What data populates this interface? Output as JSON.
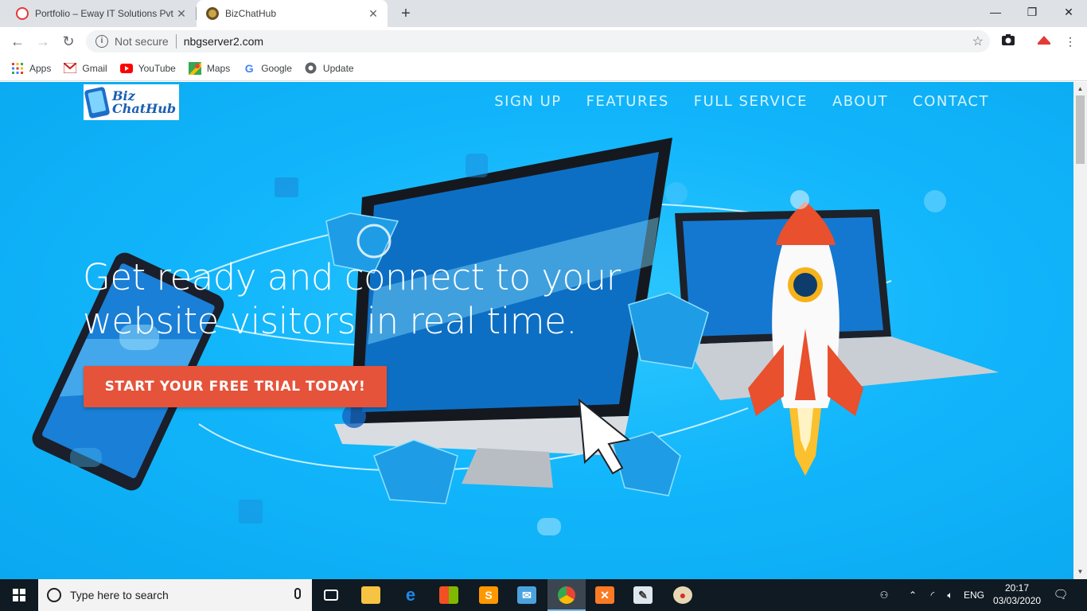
{
  "browser": {
    "tabs": [
      {
        "title": "Portfolio – Eway IT Solutions Pvt",
        "active": false,
        "favicon_color": "#e53935"
      },
      {
        "title": "BizChatHub",
        "active": true,
        "favicon_color": "#8d6e3f"
      }
    ],
    "new_tab_label": "+",
    "window_controls": {
      "minimize": "—",
      "restore": "❐",
      "close": "✕"
    },
    "address_bar": {
      "security_label": "Not secure",
      "url": "nbgserver2.com"
    },
    "bookmarks": [
      {
        "label": "Apps",
        "icon": "apps-grid-icon"
      },
      {
        "label": "Gmail",
        "icon": "gmail-icon"
      },
      {
        "label": "YouTube",
        "icon": "youtube-icon"
      },
      {
        "label": "Maps",
        "icon": "maps-icon"
      },
      {
        "label": "Google",
        "icon": "google-icon"
      },
      {
        "label": "Update",
        "icon": "update-icon"
      }
    ]
  },
  "page": {
    "logo": {
      "line1": "Biz",
      "line2": "ChatHub"
    },
    "nav": [
      "SIGN UP",
      "FEATURES",
      "FULL SERVICE",
      "ABOUT",
      "CONTACT"
    ],
    "hero": {
      "headline_line1": "Get ready and connect to your",
      "headline_line2": "website visitors in real time.",
      "cta_label": "START YOUR FREE TRIAL TODAY!"
    },
    "colors": {
      "hero_bg": "#12b6fb",
      "cta": "#e5533a",
      "nav_text": "#d7f3ff"
    }
  },
  "taskbar": {
    "search_placeholder": "Type here to search",
    "apps": [
      "task-view",
      "file-explorer",
      "edge",
      "store",
      "sublime-text",
      "mail",
      "chrome",
      "xampp",
      "notepad",
      "paint"
    ],
    "tray": {
      "language": "ENG",
      "time": "20:17",
      "date": "03/03/2020"
    }
  }
}
